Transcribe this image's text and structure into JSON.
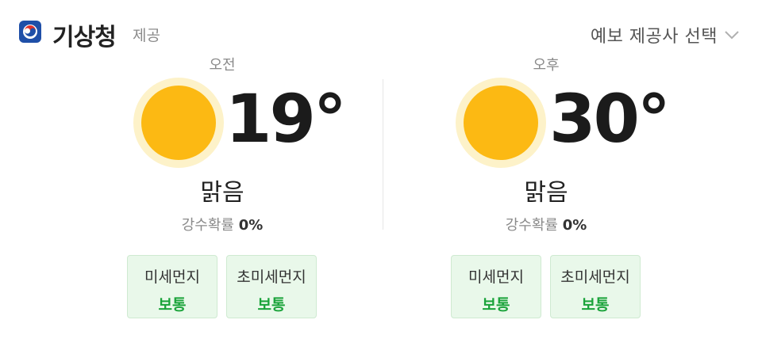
{
  "header": {
    "brand": "기상청",
    "provided": "제공",
    "provider_select_label": "예보 제공사 선택"
  },
  "forecast": [
    {
      "period": "오전",
      "temperature": "19°",
      "condition": "맑음",
      "rain_label": "강수확률",
      "rain_value": "0%",
      "dust": [
        {
          "name": "미세먼지",
          "level": "보통"
        },
        {
          "name": "초미세먼지",
          "level": "보통"
        }
      ]
    },
    {
      "period": "오후",
      "temperature": "30°",
      "condition": "맑음",
      "rain_label": "강수확률",
      "rain_value": "0%",
      "dust": [
        {
          "name": "미세먼지",
          "level": "보통"
        },
        {
          "name": "초미세먼지",
          "level": "보통"
        }
      ]
    }
  ],
  "icons": {
    "weather": "sun-icon",
    "provider_chevron": "chevron-down-icon",
    "logo": "kma-logo-icon"
  },
  "colors": {
    "sun_fill": "#fcb913",
    "sun_glow": "#fdf2c9",
    "dust_good_bg": "#e9f8ea",
    "dust_good_text": "#1aa33a"
  }
}
